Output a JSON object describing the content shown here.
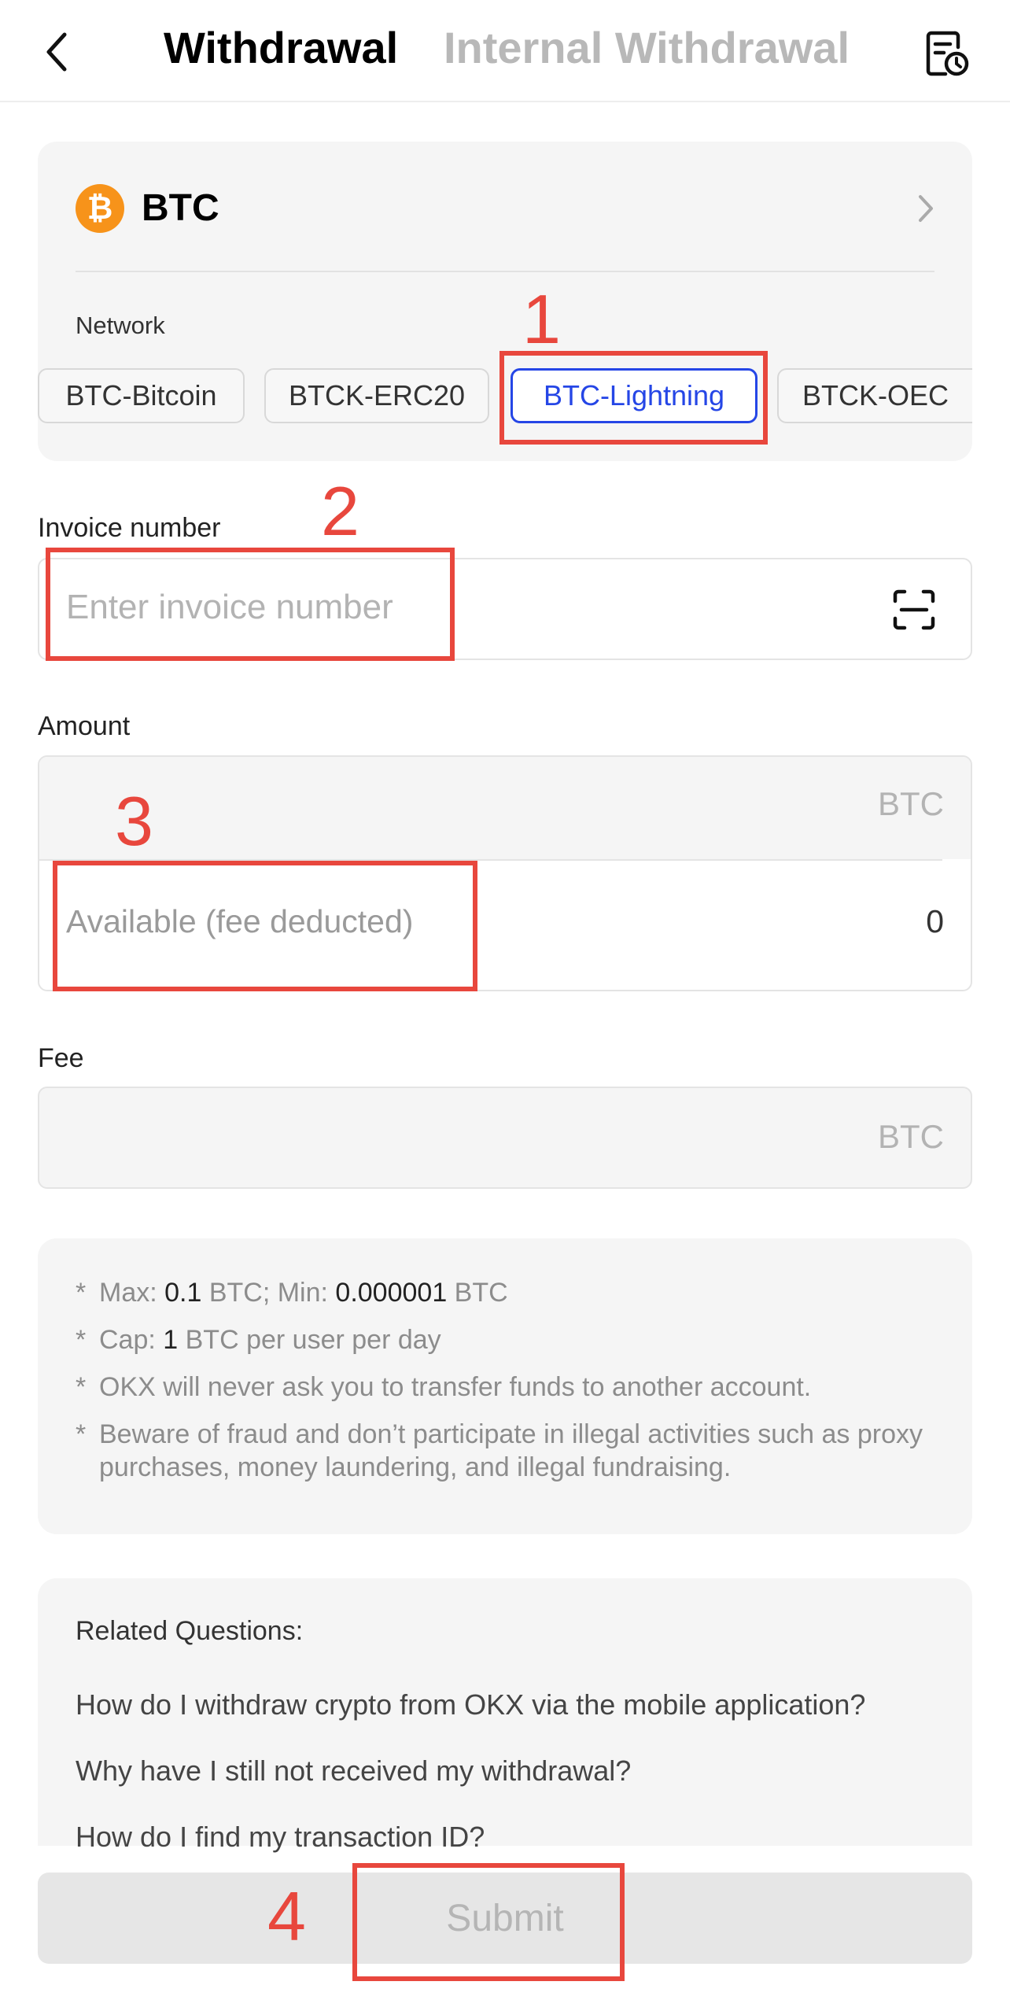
{
  "header": {
    "tabs": [
      "Withdrawal",
      "Internal Withdrawal"
    ]
  },
  "coin": {
    "symbol": "BTC",
    "logo_glyph": "₿",
    "logo_color": "#f7931a"
  },
  "network": {
    "label": "Network",
    "options": [
      "BTC-Bitcoin",
      "BTCK-ERC20",
      "BTC-Lightning",
      "BTCK-OEC"
    ],
    "selected": "BTC-Lightning"
  },
  "invoice": {
    "label": "Invoice number",
    "placeholder": "Enter invoice number",
    "value": ""
  },
  "amount": {
    "label": "Amount",
    "unit": "BTC",
    "available_label": "Available (fee deducted)",
    "available_value": "0"
  },
  "fee": {
    "label": "Fee",
    "unit": "BTC"
  },
  "notes": {
    "bullet": "*",
    "max_label": "Max: ",
    "max_value": "0.1",
    "max_unit": " BTC; Min: ",
    "min_value": "0.000001",
    "min_unit": " BTC",
    "cap_label": "Cap: ",
    "cap_value": "1",
    "cap_unit": " BTC per user per day",
    "warning": "OKX will never ask you to transfer funds to another account.",
    "fraud": "Beware of fraud and don’t participate in illegal activities such as proxy purchases, money laundering, and illegal fundraising."
  },
  "related": {
    "title": "Related Questions:",
    "questions": [
      "How do I withdraw crypto from OKX via the mobile application?",
      "Why have I still not received my withdrawal?",
      "How do I find my transaction ID?"
    ]
  },
  "submit": {
    "label": "Submit"
  },
  "annotations": [
    "1",
    "2",
    "3",
    "4"
  ],
  "colors": {
    "accent": "#2546e6",
    "annotation": "#e8473d"
  },
  "icons": {
    "back": "chevron-left-icon",
    "history": "withdrawal-history-icon",
    "coin_chevron": "chevron-right-icon",
    "scan": "scan-icon"
  }
}
